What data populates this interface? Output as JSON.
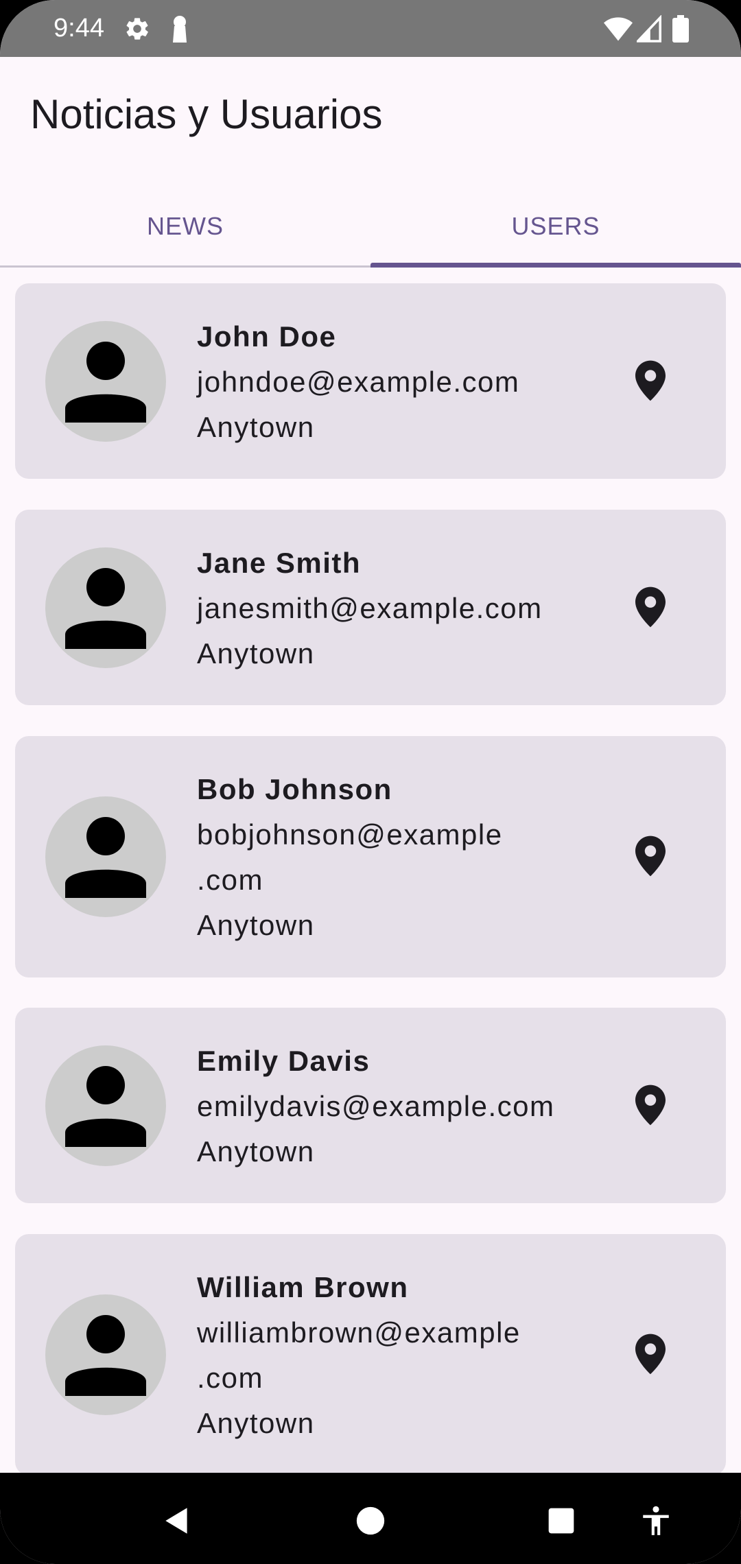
{
  "status_bar": {
    "time": "9:44"
  },
  "app": {
    "title": "Noticias y Usuarios"
  },
  "tabs": [
    {
      "label": "NEWS",
      "selected": false
    },
    {
      "label": "USERS",
      "selected": true
    }
  ],
  "users": [
    {
      "name": "John Doe",
      "email": "johndoe@example.com",
      "city": "Anytown"
    },
    {
      "name": "Jane Smith",
      "email": "janesmith@example.com",
      "city": "Anytown"
    },
    {
      "name": "Bob Johnson",
      "email": "bobjohnson@example\n.com",
      "city": "Anytown"
    },
    {
      "name": "Emily Davis",
      "email": "emilydavis@example.com",
      "city": "Anytown"
    },
    {
      "name": "William Brown",
      "email": "williambrown@example\n.com",
      "city": "Anytown"
    }
  ],
  "icons": {
    "avatar": "person-icon",
    "location": "location-pin-icon"
  },
  "colors": {
    "accent": "#65558F",
    "card": "#E6E0E9",
    "background": "#FDF7FC",
    "status_bar": "#777777"
  }
}
